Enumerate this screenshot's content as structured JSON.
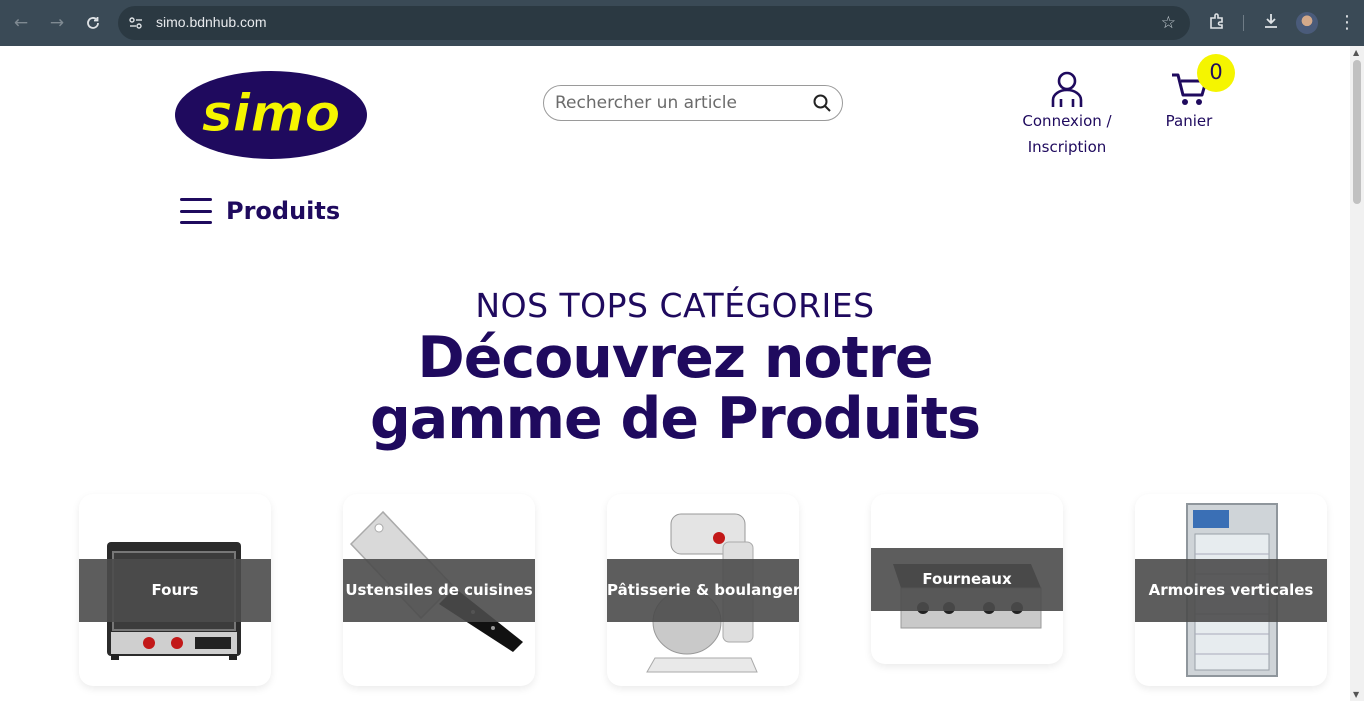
{
  "browser": {
    "url": "simo.bdnhub.com",
    "icons": [
      "back-arrow-icon",
      "forward-arrow-icon",
      "reload-icon",
      "site-settings-icon",
      "star-icon",
      "extensions-icon",
      "download-icon",
      "profile-avatar",
      "menu-kebab-icon"
    ]
  },
  "header": {
    "logo_text": "simo",
    "search_placeholder": "Rechercher un article",
    "account_line1": "Connexion /",
    "account_line2": "Inscription",
    "cart_label": "Panier",
    "cart_count": "0"
  },
  "nav": {
    "menu_label": "Produits"
  },
  "hero": {
    "kicker": "NOS TOPS CATÉGORIES",
    "title_line1": "Découvrez notre",
    "title_line2": "gamme de Produits"
  },
  "categories": [
    {
      "label": "Fours"
    },
    {
      "label": "Ustensiles de cuisines"
    },
    {
      "label": "Pâtisserie & boulangerie"
    },
    {
      "label": "Fourneaux"
    },
    {
      "label": "Armoires verticales"
    }
  ],
  "colors": {
    "brand_navy": "#1f0a5e",
    "brand_yellow": "#f5f500",
    "chrome_bar": "#3a4a56"
  }
}
